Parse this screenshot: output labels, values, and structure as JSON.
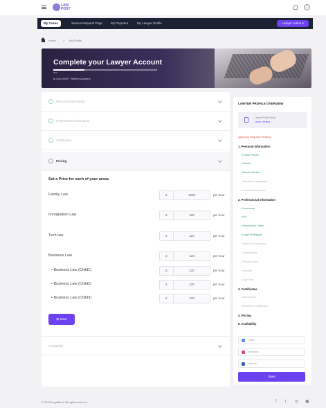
{
  "header": {
    "logo_text": "LAW\nPOST"
  },
  "nav": {
    "tabs": [
      {
        "label": "My Cases"
      },
      {
        "label": "Service Request Page"
      },
      {
        "label": "My Payment"
      },
      {
        "label": "My Lawyer Profile"
      }
    ],
    "action_label": "Lawyer Action ▾"
  },
  "breadcrumb": {
    "home": "Home",
    "separator": ">",
    "current": "My Profile"
  },
  "hero": {
    "title": "Complete your Lawyer Account",
    "progress_label": "25%",
    "progress_fraction": 0.3,
    "subtitle": "● Join 2000+ Verified Lawyers"
  },
  "sections": {
    "personal": "Personal Information",
    "professional": "Professional Information",
    "certificates": "Certificates",
    "pricing": "Pricing",
    "availability": "Availability"
  },
  "pricing": {
    "title": "Set a Price for each of your areas",
    "currency": "£",
    "unit": "per hour",
    "rows": [
      {
        "label": "Family Law",
        "value": "1200"
      },
      {
        "label": "Immigration Law",
        "value": "120"
      },
      {
        "label": "Tech law",
        "value": "120"
      },
      {
        "label": "Business Law",
        "value": "120"
      },
      {
        "label": "• Business Law (Child1)",
        "value": "120"
      },
      {
        "label": "• Business Law (Child2)",
        "value": "120"
      },
      {
        "label": "• Business Law (Child3)",
        "value": "120"
      }
    ],
    "save_label": "⊞ Save"
  },
  "sidebar": {
    "title": "LAWYER PROFILE OVERVIEW",
    "status_label": "Lawyer Profile Status",
    "status_value": "Under Verified",
    "warning": "Approval Request Pending",
    "sections": [
      {
        "heading": "1. Personal Information",
        "items": [
          {
            "label": "• Profile Picture",
            "state": "done"
          },
          {
            "label": "• Gender",
            "state": "done"
          },
          {
            "label": "• Phone Number",
            "state": "done"
          },
          {
            "label": "• Speaking Languages",
            "state": "todo"
          },
          {
            "label": "• Location/Time Zone",
            "state": "todo"
          }
        ]
      },
      {
        "heading": "2. Professional Information",
        "items": [
          {
            "label": "• Username",
            "state": "done"
          },
          {
            "label": "• Bio",
            "state": "done"
          },
          {
            "label": "• Introduction Video",
            "state": "done"
          },
          {
            "label": "• Legal Profession",
            "state": "done"
          },
          {
            "label": "• Years of Experience",
            "state": "todo"
          },
          {
            "label": "• Jurisdictions",
            "state": "todo"
          },
          {
            "label": "• Practice Area",
            "state": "todo"
          },
          {
            "label": "• Industry",
            "state": "todo"
          },
          {
            "label": "• Law Firm",
            "state": "todo"
          }
        ]
      },
      {
        "heading": "3. Certificates",
        "items": [
          {
            "label": "• Bar License",
            "state": "todo"
          },
          {
            "label": "• Academic Certificates",
            "state": "todo"
          }
        ]
      },
      {
        "heading": "4. Pricing",
        "items": []
      },
      {
        "heading": "5. Availability",
        "items": []
      }
    ],
    "socials": [
      {
        "label": "Twitter",
        "color": "#5b8def"
      },
      {
        "label": "Instagram",
        "color": "#d94d7a"
      },
      {
        "label": "LinkedIn",
        "color": "#3b5fb0"
      }
    ],
    "save_label": "Save"
  },
  "footer": {
    "copyright": "© 2023 LegalMart. All rights reserved.",
    "icons": [
      "f",
      "t",
      "◎",
      "▣"
    ]
  }
}
